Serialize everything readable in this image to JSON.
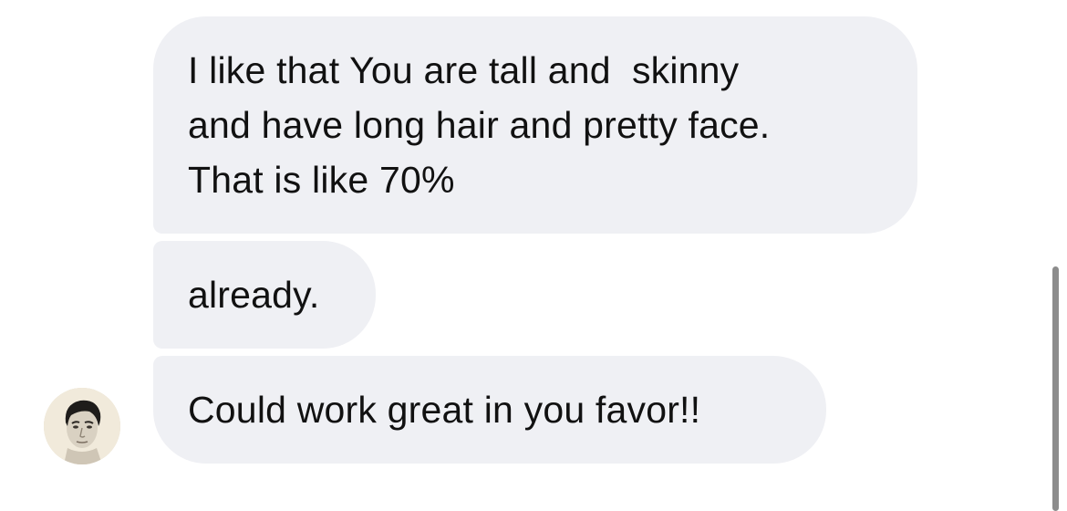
{
  "conversation": {
    "messages": [
      {
        "text": "I like that You are tall and  skinny\nand have long hair and pretty face.\nThat is like 70%"
      },
      {
        "text": "already."
      },
      {
        "text": "Could work great in you favor!!"
      }
    ],
    "sender_avatar": {
      "icon": "person-portrait-icon"
    }
  },
  "colors": {
    "bubble_background": "#eff0f4",
    "text": "#111111",
    "scrollbar": "#8c8c8c"
  }
}
